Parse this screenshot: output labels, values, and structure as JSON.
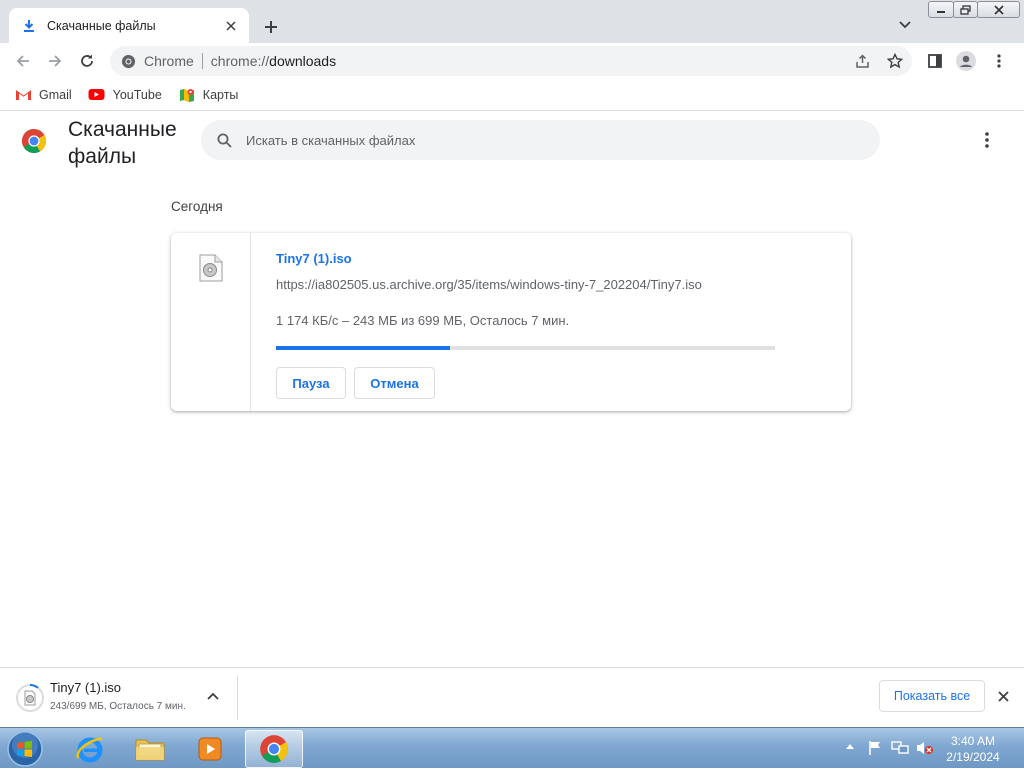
{
  "browser": {
    "tab": {
      "title": "Скачанные файлы"
    },
    "omnibox": {
      "chip": "Chrome",
      "url_scheme": "chrome://",
      "url_host": "downloads"
    },
    "bookmarks": [
      {
        "label": "Gmail",
        "icon": "gmail-icon"
      },
      {
        "label": "YouTube",
        "icon": "youtube-icon"
      },
      {
        "label": "Карты",
        "icon": "maps-icon"
      }
    ]
  },
  "page": {
    "title": "Скачанные файлы",
    "search_placeholder": "Искать в скачанных файлах",
    "date_header": "Сегодня",
    "download": {
      "filename": "Tiny7 (1).iso",
      "url": "https://ia802505.us.archive.org/35/items/windows-tiny-7_202204/Tiny7.iso",
      "status": "1 174 КБ/с – 243 МБ из 699 МБ, Осталось 7 мин.",
      "progress_fraction": 0.348,
      "pause_label": "Пауза",
      "cancel_label": "Отмена"
    }
  },
  "shelf": {
    "filename": "Tiny7 (1).iso",
    "status": "243/699 МБ, Осталось 7 мин.",
    "show_all_label": "Показать все"
  },
  "taskbar": {
    "time": "3:40 AM",
    "date": "2/19/2024"
  },
  "colors": {
    "accent": "#1a73e8",
    "tabstrip": "#dee1e6",
    "omnibox": "#f1f3f4"
  }
}
